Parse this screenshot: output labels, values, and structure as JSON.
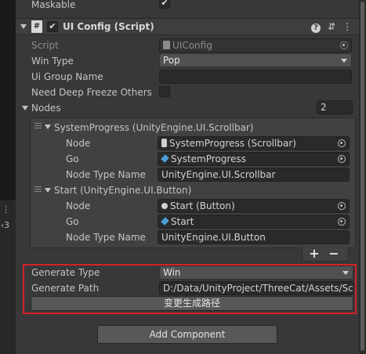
{
  "left_panel": {
    "dots_glyph": "⋮",
    "badge_text": "3"
  },
  "maskable": {
    "label": "Maskable",
    "checked": true,
    "check_glyph": "✔"
  },
  "component": {
    "title": "UI Config (Script)",
    "enabled": true,
    "check_glyph": "✔",
    "icons": [
      "help-icon",
      "presets-icon",
      "more-icon"
    ],
    "help_glyph": "?",
    "presets_glyph": "⇵",
    "more_glyph": "⋮",
    "script_glyph": "#"
  },
  "fields": {
    "script": {
      "label": "Script",
      "value": "UIConfig"
    },
    "win_type": {
      "label": "Win Type",
      "value": "Pop"
    },
    "ui_group_name": {
      "label": "Ui Group Name",
      "value": ""
    },
    "need_deep_freeze": {
      "label": "Need Deep Freeze Others",
      "checked": false
    },
    "nodes": {
      "label": "Nodes",
      "count": "2"
    }
  },
  "nodes": [
    {
      "header": "SystemProgress (UnityEngine.UI.Scrollbar)",
      "node_label": "Node",
      "node_value": "SystemProgress (Scrollbar)",
      "go_label": "Go",
      "go_value": "SystemProgress",
      "type_label": "Node Type Name",
      "type_value": "UnityEngine.UI.Scrollbar"
    },
    {
      "header": "Start (UnityEngine.UI.Button)",
      "node_label": "Node",
      "node_value": "Start (Button)",
      "go_label": "Go",
      "go_value": "Start",
      "type_label": "Node Type Name",
      "type_value": "UnityEngine.UI.Button"
    }
  ],
  "list_controls": {
    "add": "+",
    "remove": "−"
  },
  "generate": {
    "type_label": "Generate Type",
    "type_value": "Win",
    "path_label": "Generate Path",
    "path_value": "D:/Data/UnityProject/ThreeCat/Assets/Scrip",
    "button_label": "变更生成路径"
  },
  "add_component_label": "Add Component",
  "colors": {
    "highlight": "#d6202a",
    "background": "#383838",
    "field": "#2a2a2a"
  }
}
